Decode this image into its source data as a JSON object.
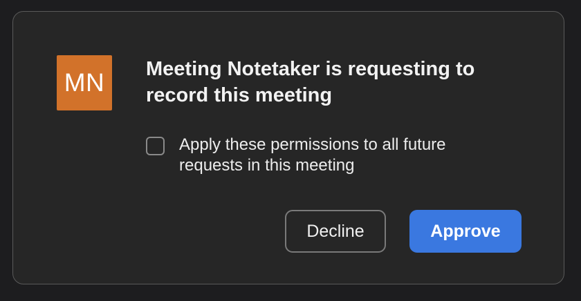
{
  "dialog": {
    "avatar_initials": "MN",
    "avatar_color": "#d2722a",
    "title": "Meeting Notetaker is requesting to record this meeting",
    "permission": {
      "label": "Apply these permissions to all future requests in this meeting",
      "checked": false
    },
    "buttons": {
      "decline_label": "Decline",
      "approve_label": "Approve"
    },
    "accent_color": "#3a78e0"
  }
}
